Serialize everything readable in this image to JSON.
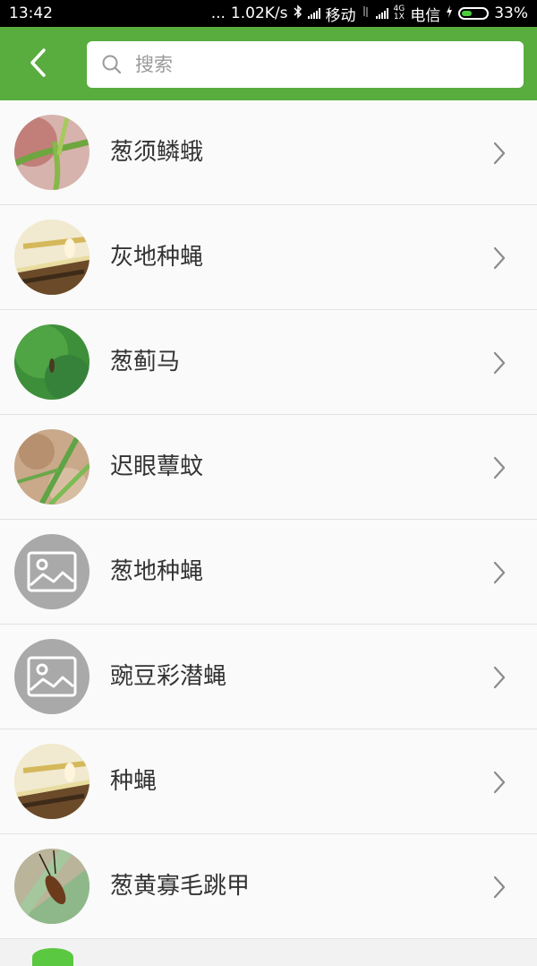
{
  "status_bar": {
    "time": "13:42",
    "dots": "...",
    "speed": "1.02K/s",
    "carrier1": "移动",
    "carrier2": "电信",
    "net_top": "4G",
    "net_bottom": "1X",
    "battery": "33%"
  },
  "header": {
    "back_icon": "chevron-left-icon",
    "search_placeholder": "搜索",
    "search_value": ""
  },
  "items": [
    {
      "name": "葱须鳞蛾",
      "thumb": "photo"
    },
    {
      "name": "灰地种蝇",
      "thumb": "photo"
    },
    {
      "name": "葱蓟马",
      "thumb": "photo"
    },
    {
      "name": "迟眼蕈蚊",
      "thumb": "photo"
    },
    {
      "name": "葱地种蝇",
      "thumb": "placeholder"
    },
    {
      "name": "豌豆彩潜蝇",
      "thumb": "placeholder"
    },
    {
      "name": "种蝇",
      "thumb": "photo"
    },
    {
      "name": "葱黄寡毛跳甲",
      "thumb": "photo"
    }
  ],
  "colors": {
    "accent": "#59ac3e",
    "list_bg": "#fafafa",
    "placeholder_thumb": "#a9a9a9"
  }
}
